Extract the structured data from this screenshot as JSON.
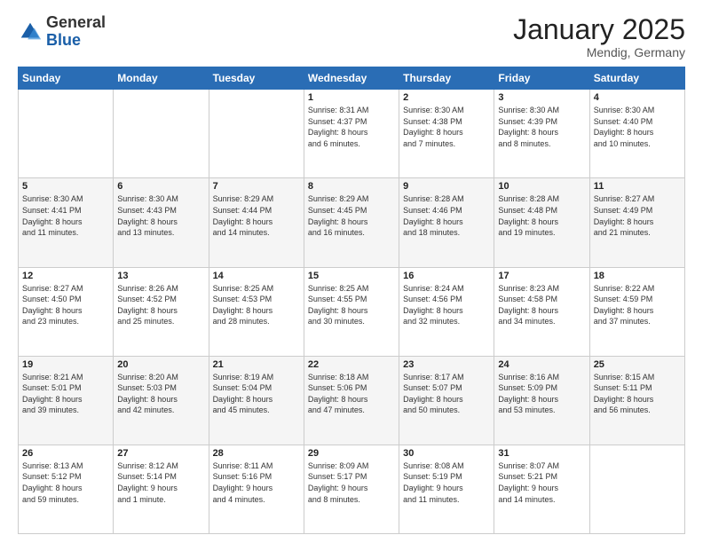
{
  "header": {
    "logo_general": "General",
    "logo_blue": "Blue",
    "month": "January 2025",
    "location": "Mendig, Germany"
  },
  "weekdays": [
    "Sunday",
    "Monday",
    "Tuesday",
    "Wednesday",
    "Thursday",
    "Friday",
    "Saturday"
  ],
  "weeks": [
    [
      {
        "day": "",
        "info": ""
      },
      {
        "day": "",
        "info": ""
      },
      {
        "day": "",
        "info": ""
      },
      {
        "day": "1",
        "info": "Sunrise: 8:31 AM\nSunset: 4:37 PM\nDaylight: 8 hours\nand 6 minutes."
      },
      {
        "day": "2",
        "info": "Sunrise: 8:30 AM\nSunset: 4:38 PM\nDaylight: 8 hours\nand 7 minutes."
      },
      {
        "day": "3",
        "info": "Sunrise: 8:30 AM\nSunset: 4:39 PM\nDaylight: 8 hours\nand 8 minutes."
      },
      {
        "day": "4",
        "info": "Sunrise: 8:30 AM\nSunset: 4:40 PM\nDaylight: 8 hours\nand 10 minutes."
      }
    ],
    [
      {
        "day": "5",
        "info": "Sunrise: 8:30 AM\nSunset: 4:41 PM\nDaylight: 8 hours\nand 11 minutes."
      },
      {
        "day": "6",
        "info": "Sunrise: 8:30 AM\nSunset: 4:43 PM\nDaylight: 8 hours\nand 13 minutes."
      },
      {
        "day": "7",
        "info": "Sunrise: 8:29 AM\nSunset: 4:44 PM\nDaylight: 8 hours\nand 14 minutes."
      },
      {
        "day": "8",
        "info": "Sunrise: 8:29 AM\nSunset: 4:45 PM\nDaylight: 8 hours\nand 16 minutes."
      },
      {
        "day": "9",
        "info": "Sunrise: 8:28 AM\nSunset: 4:46 PM\nDaylight: 8 hours\nand 18 minutes."
      },
      {
        "day": "10",
        "info": "Sunrise: 8:28 AM\nSunset: 4:48 PM\nDaylight: 8 hours\nand 19 minutes."
      },
      {
        "day": "11",
        "info": "Sunrise: 8:27 AM\nSunset: 4:49 PM\nDaylight: 8 hours\nand 21 minutes."
      }
    ],
    [
      {
        "day": "12",
        "info": "Sunrise: 8:27 AM\nSunset: 4:50 PM\nDaylight: 8 hours\nand 23 minutes."
      },
      {
        "day": "13",
        "info": "Sunrise: 8:26 AM\nSunset: 4:52 PM\nDaylight: 8 hours\nand 25 minutes."
      },
      {
        "day": "14",
        "info": "Sunrise: 8:25 AM\nSunset: 4:53 PM\nDaylight: 8 hours\nand 28 minutes."
      },
      {
        "day": "15",
        "info": "Sunrise: 8:25 AM\nSunset: 4:55 PM\nDaylight: 8 hours\nand 30 minutes."
      },
      {
        "day": "16",
        "info": "Sunrise: 8:24 AM\nSunset: 4:56 PM\nDaylight: 8 hours\nand 32 minutes."
      },
      {
        "day": "17",
        "info": "Sunrise: 8:23 AM\nSunset: 4:58 PM\nDaylight: 8 hours\nand 34 minutes."
      },
      {
        "day": "18",
        "info": "Sunrise: 8:22 AM\nSunset: 4:59 PM\nDaylight: 8 hours\nand 37 minutes."
      }
    ],
    [
      {
        "day": "19",
        "info": "Sunrise: 8:21 AM\nSunset: 5:01 PM\nDaylight: 8 hours\nand 39 minutes."
      },
      {
        "day": "20",
        "info": "Sunrise: 8:20 AM\nSunset: 5:03 PM\nDaylight: 8 hours\nand 42 minutes."
      },
      {
        "day": "21",
        "info": "Sunrise: 8:19 AM\nSunset: 5:04 PM\nDaylight: 8 hours\nand 45 minutes."
      },
      {
        "day": "22",
        "info": "Sunrise: 8:18 AM\nSunset: 5:06 PM\nDaylight: 8 hours\nand 47 minutes."
      },
      {
        "day": "23",
        "info": "Sunrise: 8:17 AM\nSunset: 5:07 PM\nDaylight: 8 hours\nand 50 minutes."
      },
      {
        "day": "24",
        "info": "Sunrise: 8:16 AM\nSunset: 5:09 PM\nDaylight: 8 hours\nand 53 minutes."
      },
      {
        "day": "25",
        "info": "Sunrise: 8:15 AM\nSunset: 5:11 PM\nDaylight: 8 hours\nand 56 minutes."
      }
    ],
    [
      {
        "day": "26",
        "info": "Sunrise: 8:13 AM\nSunset: 5:12 PM\nDaylight: 8 hours\nand 59 minutes."
      },
      {
        "day": "27",
        "info": "Sunrise: 8:12 AM\nSunset: 5:14 PM\nDaylight: 9 hours\nand 1 minute."
      },
      {
        "day": "28",
        "info": "Sunrise: 8:11 AM\nSunset: 5:16 PM\nDaylight: 9 hours\nand 4 minutes."
      },
      {
        "day": "29",
        "info": "Sunrise: 8:09 AM\nSunset: 5:17 PM\nDaylight: 9 hours\nand 8 minutes."
      },
      {
        "day": "30",
        "info": "Sunrise: 8:08 AM\nSunset: 5:19 PM\nDaylight: 9 hours\nand 11 minutes."
      },
      {
        "day": "31",
        "info": "Sunrise: 8:07 AM\nSunset: 5:21 PM\nDaylight: 9 hours\nand 14 minutes."
      },
      {
        "day": "",
        "info": ""
      }
    ]
  ]
}
